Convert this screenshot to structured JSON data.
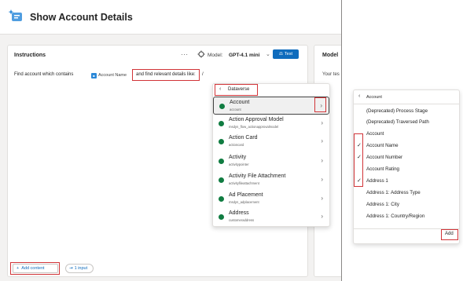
{
  "header": {
    "title": "Show Account Details"
  },
  "instructions": {
    "title": "Instructions",
    "more_label": "···",
    "model_label": "Model:",
    "model_value": "GPT-4.1 mini",
    "test_label": "Test",
    "prompt_prefix": "Find account which contains",
    "chip_label": "Account Name",
    "highlight_text": "and find relevant details like:",
    "slash": "/"
  },
  "side_card": {
    "title": "Model",
    "text": "Your tes"
  },
  "dropdown": {
    "header": "Dataverse",
    "items": [
      {
        "name": "Account",
        "sub": "account"
      },
      {
        "name": "Action Approval Model",
        "sub": "msdyn_flow_actionapprovalmodel"
      },
      {
        "name": "Action Card",
        "sub": "actioncard"
      },
      {
        "name": "Activity",
        "sub": "activitypointer"
      },
      {
        "name": "Activity File Attachment",
        "sub": "activityfileattachment"
      },
      {
        "name": "Ad Placement",
        "sub": "msdyn_adplacement"
      },
      {
        "name": "Address",
        "sub": "customeraddress"
      }
    ]
  },
  "bottom": {
    "add_content": "Add content",
    "input_label": "1 input"
  },
  "right_panel": {
    "header": "Account",
    "items": [
      {
        "label": "(Deprecated) Process Stage",
        "checked": false
      },
      {
        "label": "(Deprecated) Traversed Path",
        "checked": false
      },
      {
        "label": "Account",
        "checked": false
      },
      {
        "label": "Account Name",
        "checked": true
      },
      {
        "label": "Account Number",
        "checked": true
      },
      {
        "label": "Account Rating",
        "checked": false
      },
      {
        "label": "Address 1",
        "checked": true
      },
      {
        "label": "Address 1: Address Type",
        "checked": false
      },
      {
        "label": "Address 1: City",
        "checked": false
      },
      {
        "label": "Address 1: Country/Region",
        "checked": false
      }
    ],
    "add_label": "Add"
  },
  "colors": {
    "accent": "#0f6cbd",
    "highlight": "#d13438",
    "dataverse": "#107c41"
  }
}
